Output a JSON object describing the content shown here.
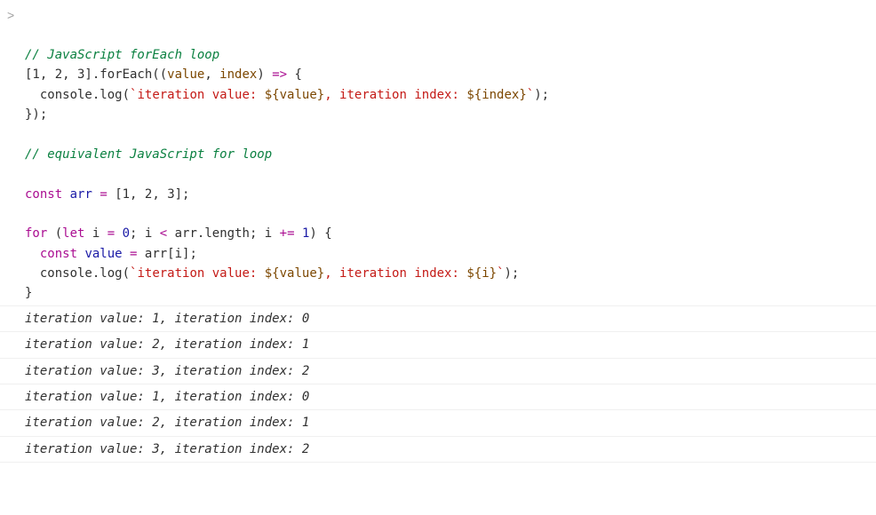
{
  "prompt_symbol": ">",
  "code": {
    "comment1": "// JavaScript forEach loop",
    "l2_array": "[1, 2, 3]",
    "l2_foreach": ".forEach((",
    "l2_value": "value",
    "l2_comma": ", ",
    "l2_index": "index",
    "l2_close": ") ",
    "l2_arrow": "=>",
    "l2_brace": " {",
    "l3_indent": "  ",
    "l3_console": "console.",
    "l3_log": "log",
    "l3_open": "(",
    "l3_str1": "`iteration value: ",
    "l3_interp1": "${value}",
    "l3_str2": ", iteration index: ",
    "l3_interp2": "${index}",
    "l3_str3": "`",
    "l3_close": ");",
    "l4": "});",
    "blank": "",
    "comment2": "// equivalent JavaScript for loop",
    "l7_const": "const",
    "l7_arr": " arr ",
    "l7_eq": "=",
    "l7_sp": " ",
    "l7_array": "[1, 2, 3]",
    "l7_semi": ";",
    "l9_for": "for",
    "l9_open": " (",
    "l9_let": "let",
    "l9_i": " i ",
    "l9_eq": "=",
    "l9_zero": " 0",
    "l9_semi1": "; i ",
    "l9_lt": "<",
    "l9_arrlen": " arr.",
    "l9_length": "length",
    "l9_semi2": "; i ",
    "l9_plus": "+=",
    "l9_one": " 1",
    "l9_close": ") {",
    "l10_indent": "  ",
    "l10_const": "const",
    "l10_value": " value ",
    "l10_eq": "=",
    "l10_arri": " arr[i];",
    "l11_indent": "  ",
    "l11_console": "console.",
    "l11_log": "log",
    "l11_open": "(",
    "l11_str1": "`iteration value: ",
    "l11_interp1": "${value}",
    "l11_str2": ", iteration index: ",
    "l11_interp2": "${i}",
    "l11_str3": "`",
    "l11_close": ");",
    "l12": "}"
  },
  "output": [
    "iteration value: 1, iteration index: 0",
    "iteration value: 2, iteration index: 1",
    "iteration value: 3, iteration index: 2",
    "iteration value: 1, iteration index: 0",
    "iteration value: 2, iteration index: 1",
    "iteration value: 3, iteration index: 2"
  ]
}
